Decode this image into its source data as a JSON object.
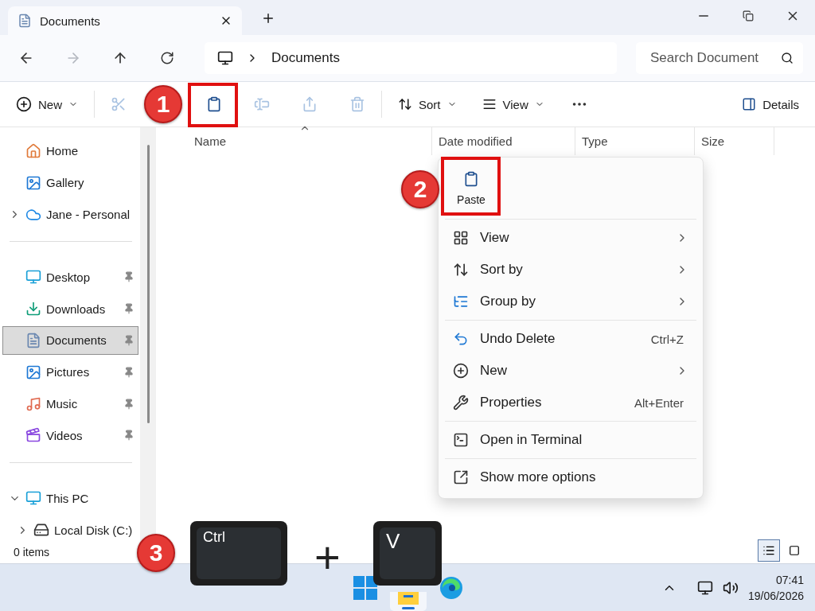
{
  "window": {
    "tab_title": "Documents"
  },
  "navigation": {
    "forward_disabled": true,
    "path": "Documents",
    "search_placeholder": "Search Document"
  },
  "command_bar": {
    "new_label": "New",
    "tools": [
      {
        "kind": "cut",
        "disabled": true
      },
      {
        "kind": "paste",
        "disabled": false
      },
      {
        "kind": "rename",
        "disabled": true
      },
      {
        "kind": "share",
        "disabled": true
      },
      {
        "kind": "delete",
        "disabled": true
      }
    ],
    "sort_label": "Sort",
    "view_label": "View",
    "details_label": "Details"
  },
  "sidebar": {
    "groups": [
      [
        {
          "kind": "home",
          "label": "Home",
          "selected": false,
          "pinned": false
        },
        {
          "kind": "gallery",
          "label": "Gallery",
          "selected": false,
          "pinned": false
        },
        {
          "kind": "cloud",
          "label": "Jane - Personal",
          "selected": false,
          "pinned": false,
          "expanded": false
        }
      ],
      [
        {
          "kind": "desktop",
          "label": "Desktop",
          "selected": false,
          "pinned": true
        },
        {
          "kind": "downloads",
          "label": "Downloads",
          "selected": false,
          "pinned": true
        },
        {
          "kind": "documents",
          "label": "Documents",
          "selected": true,
          "pinned": true
        },
        {
          "kind": "pictures",
          "label": "Pictures",
          "selected": false,
          "pinned": true
        },
        {
          "kind": "music",
          "label": "Music",
          "selected": false,
          "pinned": true
        },
        {
          "kind": "videos",
          "label": "Videos",
          "selected": false,
          "pinned": true
        }
      ],
      [
        {
          "kind": "pc",
          "label": "This PC",
          "selected": false,
          "pinned": false,
          "expanded": true,
          "children": [
            {
              "kind": "disk",
              "label": "Local Disk (C:)",
              "selected": false,
              "pinned": false,
              "expanded": false
            }
          ]
        }
      ]
    ]
  },
  "columns": [
    {
      "label": "Name",
      "sorted": true
    },
    {
      "label": "Date modified",
      "sorted": false
    },
    {
      "label": "Type",
      "sorted": false
    },
    {
      "label": "Size",
      "sorted": false
    }
  ],
  "status": "0 items",
  "context_menu": {
    "paste_label": "Paste",
    "groups": [
      [
        {
          "kind": "view",
          "label": "View",
          "submenu": true
        },
        {
          "kind": "sort",
          "label": "Sort by",
          "submenu": true
        },
        {
          "kind": "group",
          "label": "Group by",
          "submenu": true
        }
      ],
      [
        {
          "kind": "undo",
          "label": "Undo Delete",
          "shortcut": "Ctrl+Z",
          "submenu": false
        },
        {
          "kind": "new",
          "label": "New",
          "submenu": true
        },
        {
          "kind": "properties",
          "label": "Properties",
          "shortcut": "Alt+Enter",
          "submenu": false
        }
      ],
      [
        {
          "kind": "terminal",
          "label": "Open in Terminal",
          "submenu": false
        }
      ],
      [
        {
          "kind": "more",
          "label": "Show more options",
          "submenu": false
        }
      ]
    ]
  },
  "annotations": {
    "steps": [
      "1",
      "2",
      "3"
    ],
    "keys": [
      "Ctrl",
      "V"
    ],
    "plus": "+"
  },
  "taskbar": {
    "time": "07:41",
    "date": "19/06/2026"
  }
}
